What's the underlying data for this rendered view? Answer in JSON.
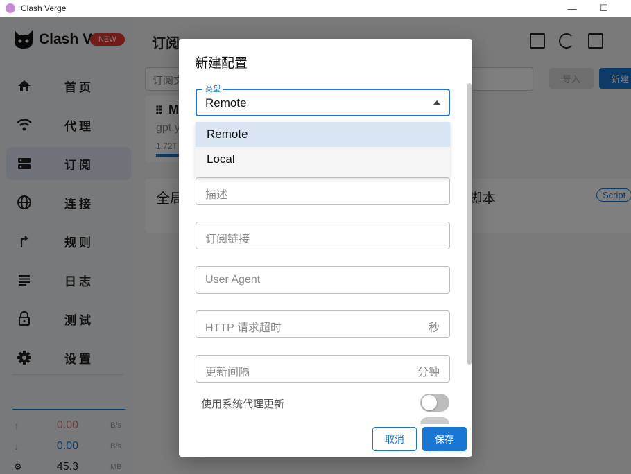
{
  "window": {
    "title": "Clash Verge",
    "minimize_glyph": "—",
    "maximize_glyph": "☐"
  },
  "sidebar": {
    "app_name": "Clash Verge",
    "badge": "NEW",
    "items": [
      {
        "label": "首页",
        "icon": "home-icon"
      },
      {
        "label": "代理",
        "icon": "wifi-icon"
      },
      {
        "label": "订阅",
        "icon": "server-icon",
        "active": true
      },
      {
        "label": "连接",
        "icon": "globe-icon"
      },
      {
        "label": "规则",
        "icon": "fork-icon"
      },
      {
        "label": "日志",
        "icon": "list-icon"
      },
      {
        "label": "测试",
        "icon": "lock-icon"
      },
      {
        "label": "设置",
        "icon": "gear-icon"
      }
    ],
    "traffic": {
      "upload": {
        "value": "0.00",
        "unit": "B/s",
        "color": "#e57373"
      },
      "download": {
        "value": "0.00",
        "unit": "B/s",
        "color": "#1976d2"
      },
      "memory": {
        "value": "45.3",
        "unit": "MB"
      }
    }
  },
  "main": {
    "title": "订阅",
    "search_placeholder": "订阅文",
    "import_label": "导入",
    "new_label": "新建",
    "profile_card": {
      "title": "M",
      "subtitle": "gpt.y",
      "usage": "1.72T"
    },
    "global_card": {
      "left": "全局",
      "right": "脚本",
      "tag": "Script"
    }
  },
  "dialog": {
    "title": "新建配置",
    "type_label": "类型",
    "type_value": "Remote",
    "type_options": [
      "Remote",
      "Local"
    ],
    "fields": {
      "desc_placeholder": "描述",
      "url_placeholder": "订阅链接",
      "ua_placeholder": "User Agent",
      "timeout_placeholder": "HTTP 请求超时",
      "timeout_unit": "秒",
      "interval_placeholder": "更新间隔",
      "interval_unit": "分钟"
    },
    "system_proxy_label": "使用系统代理更新",
    "cancel_label": "取消",
    "save_label": "保存"
  },
  "colors": {
    "accent": "#1976d2",
    "badge": "#e53935"
  }
}
